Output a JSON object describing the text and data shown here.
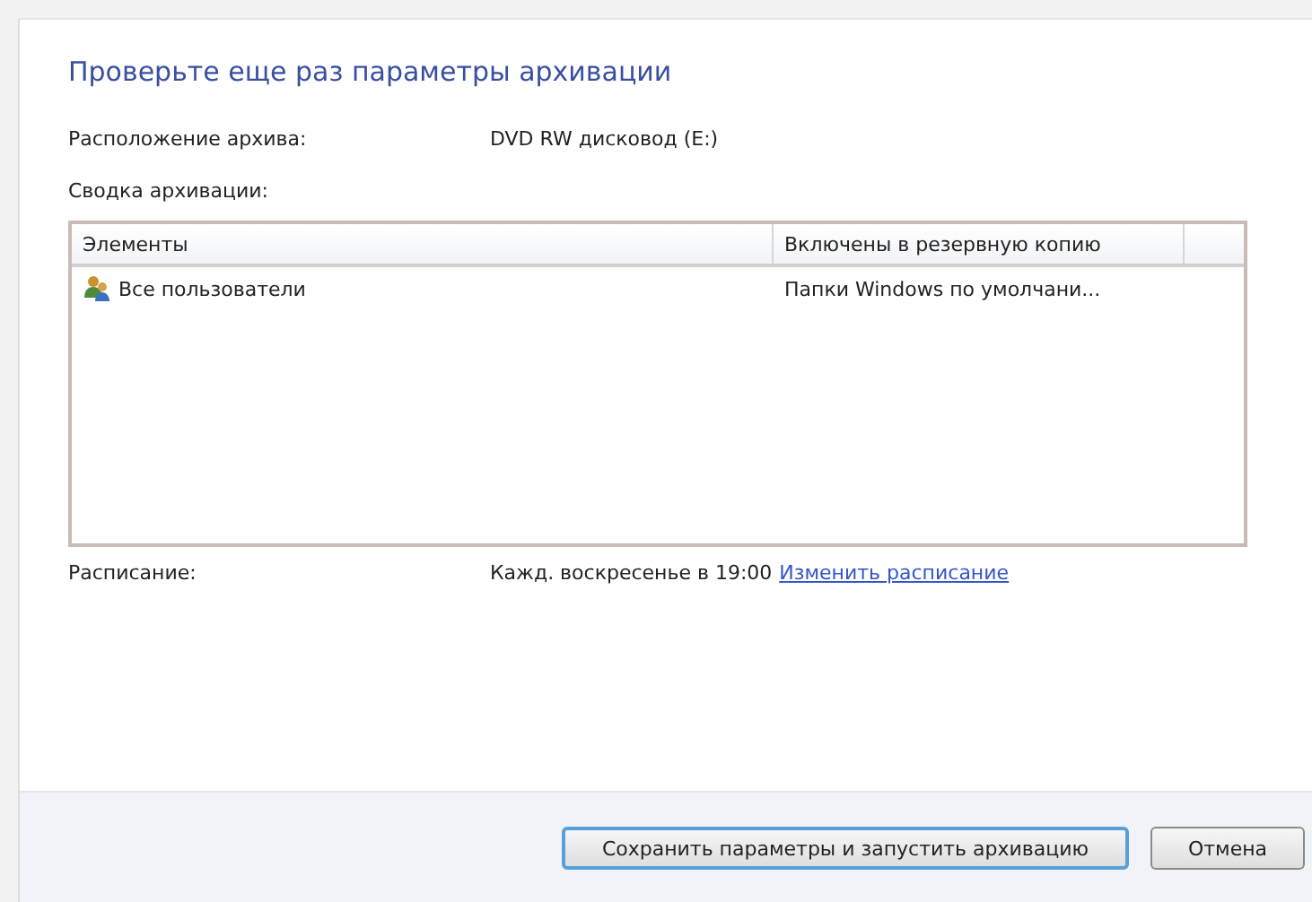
{
  "heading": "Проверьте еще раз параметры архивации",
  "location": {
    "label": "Расположение архива:",
    "value": "DVD RW дисковод (E:)"
  },
  "summary": {
    "label": "Сводка архивации:",
    "columns": [
      "Элементы",
      "Включены в резервную копию"
    ],
    "rows": [
      {
        "item": "Все пользователи",
        "included": "Папки Windows по умолчани..."
      }
    ]
  },
  "schedule": {
    "label": "Расписание:",
    "value": "Кажд. воскресенье в 19:00",
    "link": "Изменить расписание"
  },
  "buttons": [
    {
      "label": "Сохранить параметры и запустить архивацию",
      "kind": "default"
    },
    {
      "label": "Отмена",
      "kind": "normal"
    }
  ]
}
